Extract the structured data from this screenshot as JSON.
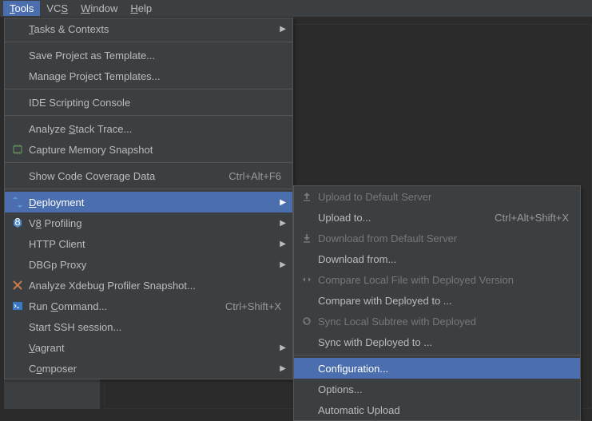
{
  "menubar": {
    "tools": "Tools",
    "vcs": "VCS",
    "window": "Window",
    "help": "Help"
  },
  "toolsMenu": {
    "tasks": "Tasks & Contexts",
    "saveTemplate": "Save Project as Template...",
    "manageTemplates": "Manage Project Templates...",
    "ideScripting": "IDE Scripting Console",
    "analyzeStack": "Analyze Stack Trace...",
    "captureMemory": "Capture Memory Snapshot",
    "coverage": "Show Code Coverage Data",
    "coverageShortcut": "Ctrl+Alt+F6",
    "deployment": "Deployment",
    "v8profiling": "V8 Profiling",
    "httpClient": "HTTP Client",
    "dbgp": "DBGp Proxy",
    "xdebug": "Analyze Xdebug Profiler Snapshot...",
    "runCommand": "Run Command...",
    "runCommandShortcut": "Ctrl+Shift+X",
    "ssh": "Start SSH session...",
    "vagrant": "Vagrant",
    "composer": "Composer"
  },
  "deployMenu": {
    "uploadDefault": "Upload to Default Server",
    "uploadTo": "Upload to...",
    "uploadToShortcut": "Ctrl+Alt+Shift+X",
    "downloadDefault": "Download from Default Server",
    "downloadFrom": "Download from...",
    "compareLocal": "Compare Local File with Deployed Version",
    "compareDeployed": "Compare with Deployed to ...",
    "syncLocal": "Sync Local Subtree with Deployed",
    "syncDeployed": "Sync with Deployed to ...",
    "configuration": "Configuration...",
    "options": "Options...",
    "autoUpload": "Automatic Upload"
  }
}
